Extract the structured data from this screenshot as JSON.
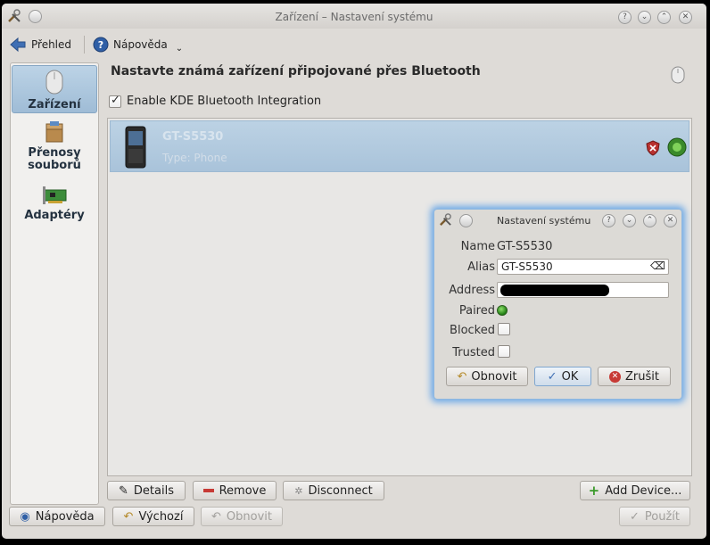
{
  "window": {
    "title": "Zařízení – Nastavení systému"
  },
  "toolbar": {
    "back_label": "Přehled",
    "help_label": "Nápověda"
  },
  "sidebar": {
    "items": [
      {
        "label": "Zařízení"
      },
      {
        "label": "Přenosy souborů"
      },
      {
        "label": "Adaptéry"
      }
    ]
  },
  "main": {
    "heading": "Nastavte známá zařízení připojované přes Bluetooth",
    "enable_label": "Enable KDE Bluetooth Integration",
    "device": {
      "name": "GT-S5530",
      "type": "Type: Phone"
    },
    "buttons": {
      "details": "Details",
      "remove": "Remove",
      "disconnect": "Disconnect",
      "add": "Add Device..."
    }
  },
  "footer": {
    "help": "Nápověda",
    "default": "Výchozí",
    "reset": "Obnovit",
    "apply": "Použít"
  },
  "dialog": {
    "title": "Nastavení systému",
    "name_label": "Name",
    "name_value": "GT-S5530",
    "alias_label": "Alias",
    "alias_value": "GT-S5530",
    "address_label": "Address",
    "address_value": "",
    "paired_label": "Paired",
    "blocked_label": "Blocked",
    "trusted_label": "Trusted",
    "reset_label": "Obnovit",
    "ok_label": "OK",
    "cancel_label": "Zrušit"
  },
  "colors": {
    "selection": "#a9c3da",
    "accent": "#6aa7e6",
    "led_green": "#1e7c12"
  }
}
